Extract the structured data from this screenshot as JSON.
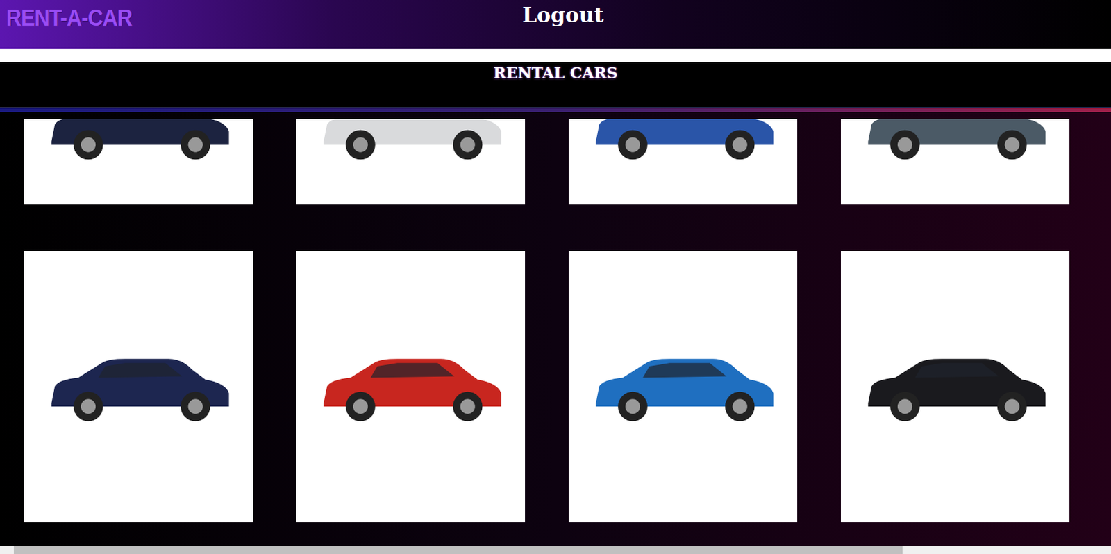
{
  "header": {
    "logo": "RENT-A-CAR",
    "logout": "Logout"
  },
  "section": {
    "title": "RENTAL CARS"
  },
  "cars": [
    {
      "color": "#1c2340"
    },
    {
      "color": "#d9dadc"
    },
    {
      "color": "#2a55a8"
    },
    {
      "color": "#4b5a66"
    },
    {
      "color": "#1d2650"
    },
    {
      "color": "#c8261f"
    },
    {
      "color": "#1f6fc0"
    },
    {
      "color": "#1a1a1e"
    }
  ],
  "scrollbar": {
    "level": 0.8
  }
}
